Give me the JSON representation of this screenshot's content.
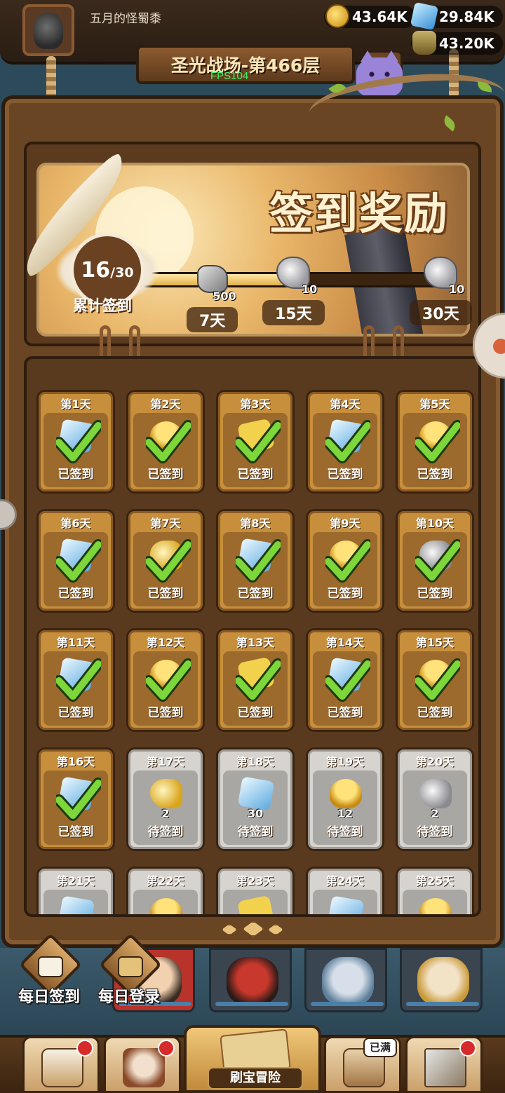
{
  "header": {
    "player_name": "五月的怪蜀黍",
    "resources": {
      "gold": "43.64K",
      "gems": "29.84K",
      "potion": "43.20K"
    },
    "stage_title": "圣光战场-第466层",
    "fps": "FPS104",
    "switch_label": "切"
  },
  "banner": {
    "title": "签到奖励",
    "cumulative": {
      "current": "16",
      "total": "30",
      "label": "累计签到"
    },
    "progress_fraction": 0.53,
    "milestones": [
      {
        "days": "7天",
        "qty": "500",
        "icon": "stone-icon"
      },
      {
        "days": "15天",
        "qty": "10",
        "icon": "silver-horn-icon"
      },
      {
        "days": "30天",
        "qty": "10",
        "icon": "silver-horn-icon"
      }
    ]
  },
  "days": [
    {
      "title": "第1天",
      "status": "已签到",
      "state": "done",
      "qty": "",
      "icon": "crystal-icon"
    },
    {
      "title": "第2天",
      "status": "已签到",
      "state": "done",
      "qty": "",
      "icon": "hero-token-icon"
    },
    {
      "title": "第3天",
      "status": "已签到",
      "state": "done",
      "qty": "",
      "icon": "puzzle-icon"
    },
    {
      "title": "第4天",
      "status": "已签到",
      "state": "done",
      "qty": "",
      "icon": "crystal-icon"
    },
    {
      "title": "第5天",
      "status": "已签到",
      "state": "done",
      "qty": "",
      "icon": "hero-token-icon"
    },
    {
      "title": "第6天",
      "status": "已签到",
      "state": "done",
      "qty": "",
      "icon": "crystal-icon"
    },
    {
      "title": "第7天",
      "status": "已签到",
      "state": "done",
      "qty": "",
      "icon": "gold-horn-icon"
    },
    {
      "title": "第8天",
      "status": "已签到",
      "state": "done",
      "qty": "",
      "icon": "crystal-icon"
    },
    {
      "title": "第9天",
      "status": "已签到",
      "state": "done",
      "qty": "",
      "icon": "hero-token-icon"
    },
    {
      "title": "第10天",
      "status": "已签到",
      "state": "done",
      "qty": "",
      "icon": "silver-horn-icon"
    },
    {
      "title": "第11天",
      "status": "已签到",
      "state": "done",
      "qty": "",
      "icon": "crystal-icon"
    },
    {
      "title": "第12天",
      "status": "已签到",
      "state": "done",
      "qty": "",
      "icon": "hero-token-icon"
    },
    {
      "title": "第13天",
      "status": "已签到",
      "state": "done",
      "qty": "",
      "icon": "puzzle-icon"
    },
    {
      "title": "第14天",
      "status": "已签到",
      "state": "done",
      "qty": "",
      "icon": "crystal-icon"
    },
    {
      "title": "第15天",
      "status": "已签到",
      "state": "done",
      "qty": "",
      "icon": "hero-token-icon"
    },
    {
      "title": "第16天",
      "status": "已签到",
      "state": "done",
      "qty": "",
      "icon": "crystal-icon"
    },
    {
      "title": "第17天",
      "status": "待签到",
      "state": "pending",
      "qty": "2",
      "icon": "gold-horn-icon"
    },
    {
      "title": "第18天",
      "status": "待签到",
      "state": "pending",
      "qty": "30",
      "icon": "crystal-icon"
    },
    {
      "title": "第19天",
      "status": "待签到",
      "state": "pending",
      "qty": "12",
      "icon": "hero-token-icon"
    },
    {
      "title": "第20天",
      "status": "待签到",
      "state": "pending",
      "qty": "2",
      "icon": "silver-horn-icon"
    },
    {
      "title": "第21天",
      "status": "",
      "state": "pending",
      "qty": "",
      "icon": "crystal-icon"
    },
    {
      "title": "第22天",
      "status": "",
      "state": "pending",
      "qty": "",
      "icon": "hero-token-icon"
    },
    {
      "title": "第23天",
      "status": "",
      "state": "pending",
      "qty": "",
      "icon": "puzzle-icon"
    },
    {
      "title": "第24天",
      "status": "",
      "state": "pending",
      "qty": "",
      "icon": "crystal-icon"
    },
    {
      "title": "第25天",
      "status": "",
      "state": "pending",
      "qty": "",
      "icon": "hero-token-icon"
    }
  ],
  "side_buttons": {
    "daily_signin": "每日签到",
    "daily_login": "每日登录"
  },
  "bottom_nav": {
    "center_label": "刷宝冒险",
    "full_tag": "已满"
  },
  "colors": {
    "done_card": "#c78f3c",
    "pending_card": "#d7d4cf",
    "check": "#7dd63a",
    "board": "#6a4524"
  }
}
